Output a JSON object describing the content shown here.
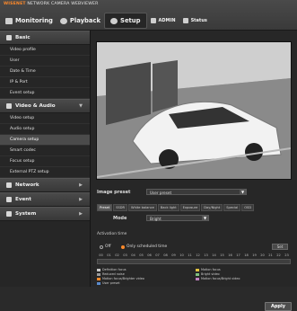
{
  "brand": {
    "prefix": "WISENET",
    "title": "NETWORK CAMERA WEBVIEWER"
  },
  "topnav": {
    "monitoring": "Monitoring",
    "playback": "Playback",
    "setup": "Setup",
    "admin": "ADMIN",
    "status": "Status"
  },
  "sidebar": {
    "basic": "Basic",
    "basic_items": [
      "Video profile",
      "User",
      "Date & Time",
      "IP & Port",
      "Event setup"
    ],
    "video_audio": "Video & Audio",
    "va_items": [
      "Video setup",
      "Audio setup",
      "Camera setup",
      "Smart codec",
      "Focus setup",
      "External PTZ setup"
    ],
    "network": "Network",
    "event": "Event",
    "system": "System"
  },
  "form": {
    "image_preset_label": "Image preset",
    "image_preset_value": "User preset",
    "tabs": [
      "Preset",
      "SSDR",
      "White balance",
      "Back light",
      "Exposure",
      "Day/Night",
      "Special",
      "OSD"
    ],
    "mode_label": "Mode",
    "mode_value": "Bright"
  },
  "schedule": {
    "header": "Activation time",
    "off": "Off",
    "only_scheduled": "Only scheduled time",
    "set": "Set",
    "hours": [
      "00",
      "01",
      "02",
      "03",
      "04",
      "05",
      "06",
      "07",
      "08",
      "09",
      "10",
      "11",
      "12",
      "13",
      "14",
      "15",
      "16",
      "17",
      "18",
      "19",
      "20",
      "21",
      "22",
      "23"
    ],
    "legend": [
      "Definition focus",
      "Reduced noise",
      "Motion focus/Brighter video",
      "User preset",
      "Motion focus",
      "Bright video",
      "Motion focus/Bright video"
    ]
  },
  "apply": "Apply",
  "colors": {
    "accent": "#ff8a2a"
  }
}
